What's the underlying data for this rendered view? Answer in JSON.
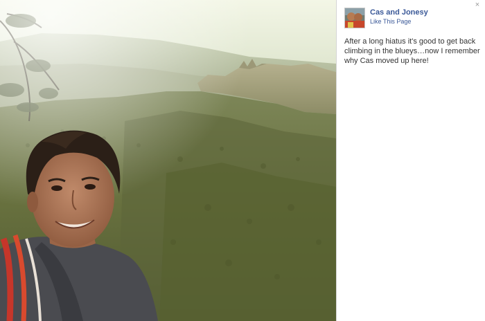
{
  "photo": {
    "alt_subject": "photo"
  },
  "sidebar": {
    "close_glyph": "×",
    "page_name": "Cas and Jonesy",
    "like_label": "Like This Page",
    "caption": "After a long hiatus it's good to get back climbing in the blueys…now I remember why Cas moved up here!"
  },
  "icons": {
    "close": "close-icon",
    "avatar": "page-avatar"
  },
  "colors": {
    "link": "#3b5998",
    "text": "#333333",
    "close": "#9a9a9a"
  }
}
